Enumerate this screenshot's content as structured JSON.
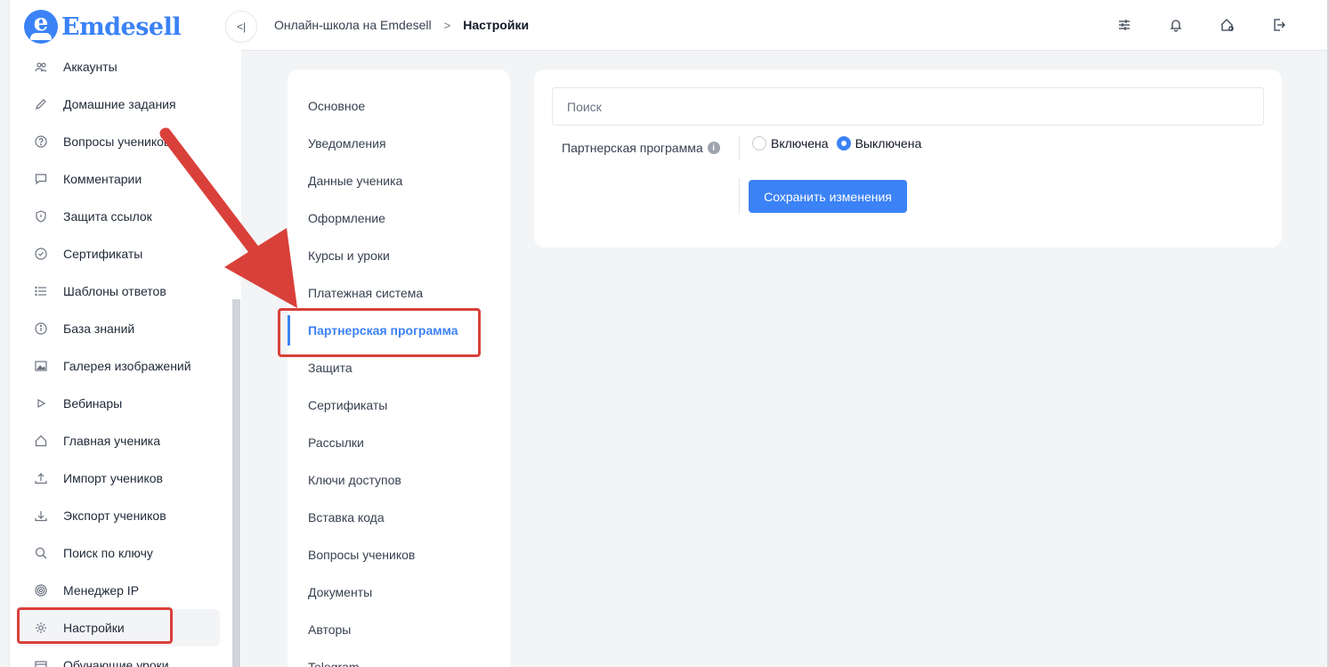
{
  "logo": {
    "letter": "e",
    "text": "Emdesell"
  },
  "sidebar": {
    "items": [
      {
        "label": "Аккаунты",
        "icon": "users-icon"
      },
      {
        "label": "Домашние задания",
        "icon": "pencil-icon"
      },
      {
        "label": "Вопросы учеников",
        "icon": "question-icon"
      },
      {
        "label": "Комментарии",
        "icon": "comment-icon"
      },
      {
        "label": "Защита ссылок",
        "icon": "shield-icon"
      },
      {
        "label": "Сертификаты",
        "icon": "badge-check-icon"
      },
      {
        "label": "Шаблоны ответов",
        "icon": "list-icon"
      },
      {
        "label": "База знаний",
        "icon": "info-icon"
      },
      {
        "label": "Галерея изображений",
        "icon": "image-icon"
      },
      {
        "label": "Вебинары",
        "icon": "play-icon"
      },
      {
        "label": "Главная ученика",
        "icon": "home-icon"
      },
      {
        "label": "Импорт учеников",
        "icon": "upload-icon"
      },
      {
        "label": "Экспорт учеников",
        "icon": "download-icon"
      },
      {
        "label": "Поиск по ключу",
        "icon": "search-icon"
      },
      {
        "label": "Менеджер IP",
        "icon": "target-icon"
      },
      {
        "label": "Настройки",
        "icon": "gear-icon",
        "active": true
      },
      {
        "label": "Обучающие уроки",
        "icon": "video-icon"
      }
    ]
  },
  "topbar": {
    "collapse_glyph": "<|",
    "breadcrumb": {
      "parent": "Онлайн-школа на Emdesell",
      "separator": ">",
      "current": "Настройки"
    },
    "icons": [
      "sliders-icon",
      "bell-icon",
      "home-settings-icon",
      "logout-icon"
    ]
  },
  "settings_menu": {
    "items": [
      "Основное",
      "Уведомления",
      "Данные ученика",
      "Оформление",
      "Курсы и уроки",
      "Платежная система",
      "Партнерская программа",
      "Защита",
      "Сертификаты",
      "Рассылки",
      "Ключи доступов",
      "Вставка кода",
      "Вопросы учеников",
      "Документы",
      "Авторы",
      "Telegram"
    ],
    "active_index": 6
  },
  "main": {
    "search": {
      "placeholder": "Поиск",
      "value": ""
    },
    "field_label": "Партнерская программа",
    "info_glyph": "i",
    "radio_on": "Включена",
    "radio_off": "Выключена",
    "selected": "Выключена",
    "save_label": "Сохранить изменения"
  },
  "colors": {
    "accent": "#3b82f6",
    "annotation": "#d9403a",
    "background": "#f3f4f6"
  }
}
